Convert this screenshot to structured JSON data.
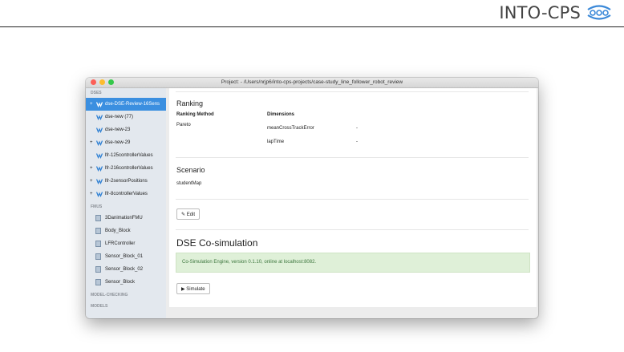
{
  "header": {
    "brand_text": "INTO-CPS",
    "logo_icon": "into-cps-logo-icon"
  },
  "window": {
    "title": "Project: - /Users/nrjp6/into-cps-projects/case-study_line_follower_robot_review",
    "sidebar": {
      "dses_label": "DSES",
      "dse_items": [
        {
          "label": "dse-DSE-Review-16Sens",
          "expandable": true,
          "selected": true
        },
        {
          "label": "dse-new (77)",
          "expandable": false
        },
        {
          "label": "dse-new-23",
          "expandable": false
        },
        {
          "label": "dse-new-29",
          "expandable": true
        },
        {
          "label": "lfr-125controllerValues",
          "expandable": false
        },
        {
          "label": "lfr-216controllerValues",
          "expandable": true
        },
        {
          "label": "lfr-2sensorPositions",
          "expandable": true
        },
        {
          "label": "lfr-8controllerValues",
          "expandable": true
        }
      ],
      "fmus_label": "FMUS",
      "fmu_items": [
        {
          "label": "3DanimationFMU"
        },
        {
          "label": "Body_Block"
        },
        {
          "label": "LFRController"
        },
        {
          "label": "Sensor_Block_01"
        },
        {
          "label": "Sensor_Block_02"
        },
        {
          "label": "Sensor_Block"
        }
      ],
      "model_checking_label": "MODEL-CHECKING",
      "models_label": "MODELS"
    },
    "main": {
      "ranking_title": "Ranking",
      "ranking_method_header": "Ranking Method",
      "dimensions_header": "Dimensions",
      "ranking_method_value": "Pareto",
      "dimensions": [
        {
          "name": "meanCrossTrackError",
          "value": "-"
        },
        {
          "name": "lapTime",
          "value": "-"
        }
      ],
      "scenario_title": "Scenario",
      "scenario_value": "studentMap",
      "edit_label": "Edit",
      "cosim_title": "DSE Co-simulation",
      "cosim_status": "Co-Simulation Engine, version 0.1.10, online at localhost:8082.",
      "simulate_label": "Simulate"
    }
  },
  "colors": {
    "selection": "#3b8fe0",
    "success_bg": "#dff0d8",
    "success_text": "#3c763d",
    "sidebar_bg": "#e3e8ee"
  }
}
